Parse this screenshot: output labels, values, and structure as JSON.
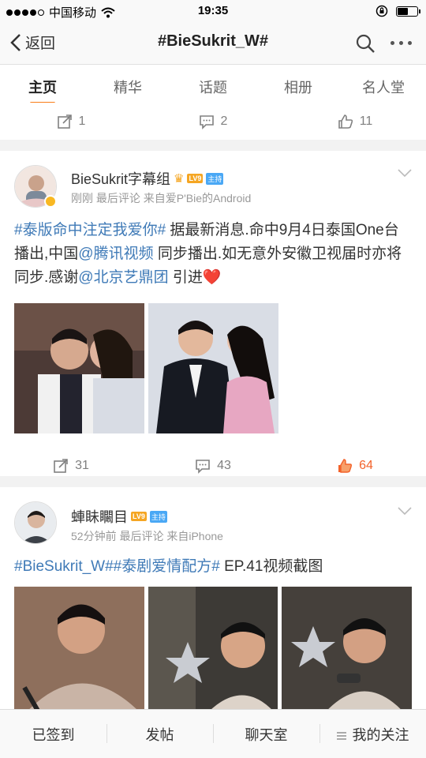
{
  "status_bar": {
    "carrier": "中国移动",
    "time": "19:35"
  },
  "nav": {
    "back_label": "返回",
    "title": "#BieSukrit_W#"
  },
  "tabs": [
    {
      "label": "主页",
      "active": true
    },
    {
      "label": "精华"
    },
    {
      "label": "话题"
    },
    {
      "label": "相册"
    },
    {
      "label": "名人堂"
    }
  ],
  "prev_post_actions": {
    "reposts": "1",
    "comments": "2",
    "likes": "11"
  },
  "post1": {
    "username": "BieSukrit字幕组",
    "level_badge": "LV9",
    "host_badge": "主持",
    "meta": "刚刚  最后评论   来自爱P'Bie的Android",
    "text": {
      "hashtag": "#泰版命中注定我爱你#",
      "part1": " 据最新消息.命中9月4日泰国One台播出,中国",
      "mention1": "@腾讯视频",
      "part2": " 同步播出.如无意外安徽卫视届时亦将同步.感谢",
      "mention2": "@北京艺鼎团",
      "part3": " 引进",
      "emoji": "❤️"
    },
    "actions": {
      "reposts": "31",
      "comments": "43",
      "likes": "64"
    }
  },
  "post2": {
    "username": "蛼眛矙目",
    "level_badge": "LV9",
    "host_badge": "主持",
    "meta": "52分钟前  最后评论   来自iPhone",
    "text": {
      "hashtag1": "#BieSukrit_W#",
      "hashtag2": "#泰剧爱情配方#",
      "part1": " EP.41视频截图"
    }
  },
  "bottom_bar": {
    "signed_in": "已签到",
    "post": "发帖",
    "chatroom": "聊天室",
    "my_follow": "我的关注"
  },
  "colors": {
    "link": "#3f7ab7",
    "accent": "#f97d18",
    "like_active": "#f3622a"
  }
}
